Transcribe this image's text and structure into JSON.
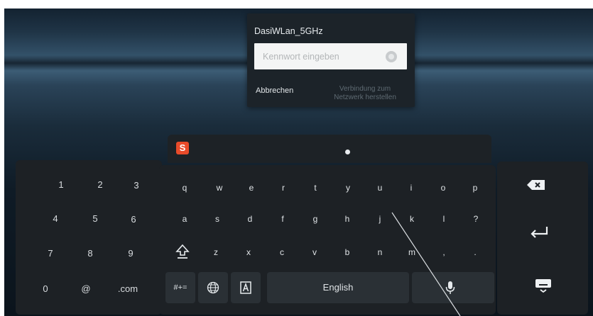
{
  "dialog": {
    "ssid": "DasiWLan_5GHz",
    "password_placeholder": "Kennwort eingeben",
    "cancel_label": "Abbrechen",
    "connect_label_line1": "Verbindung zum",
    "connect_label_line2": "Netzwerk herstellen"
  },
  "suggestion_bar": {
    "logo_letter": "S"
  },
  "numpad": {
    "row1": [
      "1",
      "2",
      "3"
    ],
    "row2": [
      "4",
      "5",
      "6"
    ],
    "row3": [
      "7",
      "8",
      "9"
    ],
    "row4": [
      "0",
      "@",
      ".com"
    ]
  },
  "letters": {
    "row1": [
      "q",
      "w",
      "e",
      "r",
      "t",
      "y",
      "u",
      "i",
      "o",
      "p"
    ],
    "row2": [
      "a",
      "s",
      "d",
      "f",
      "g",
      "h",
      "j",
      "k",
      "l",
      "?"
    ],
    "row3": [
      "z",
      "x",
      "c",
      "v",
      "b",
      "n",
      "m",
      ",",
      "."
    ]
  },
  "bottom": {
    "symbols_label": "#+=",
    "space_label": "English"
  },
  "colors": {
    "panel": "#1d2125",
    "key": "#2a3035",
    "logo": "#e84b2a"
  }
}
